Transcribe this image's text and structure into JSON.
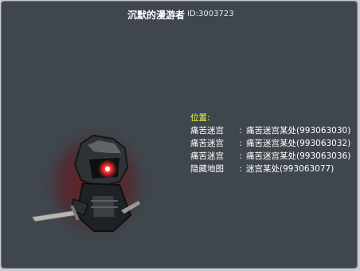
{
  "player": {
    "name": "沉默的漫游者",
    "id_label": "ID:3003723"
  },
  "location": {
    "title": "位置:",
    "entries": [
      {
        "map": "痛苦迷宫",
        "sep": ":",
        "place": "痛苦迷宫某处(993063030)"
      },
      {
        "map": "痛苦迷宫",
        "sep": ":",
        "place": "痛苦迷宫某处(993063032)"
      },
      {
        "map": "痛苦迷宫",
        "sep": ":",
        "place": "痛苦迷宫某处(993063036)"
      },
      {
        "map": "隐藏地图",
        "sep": ":",
        "place": "迷宫某处(993063077)"
      }
    ]
  },
  "colors": {
    "background": "#3f464d",
    "label_yellow": "#f2ff3a",
    "eye_red": "#ff2a2a"
  }
}
